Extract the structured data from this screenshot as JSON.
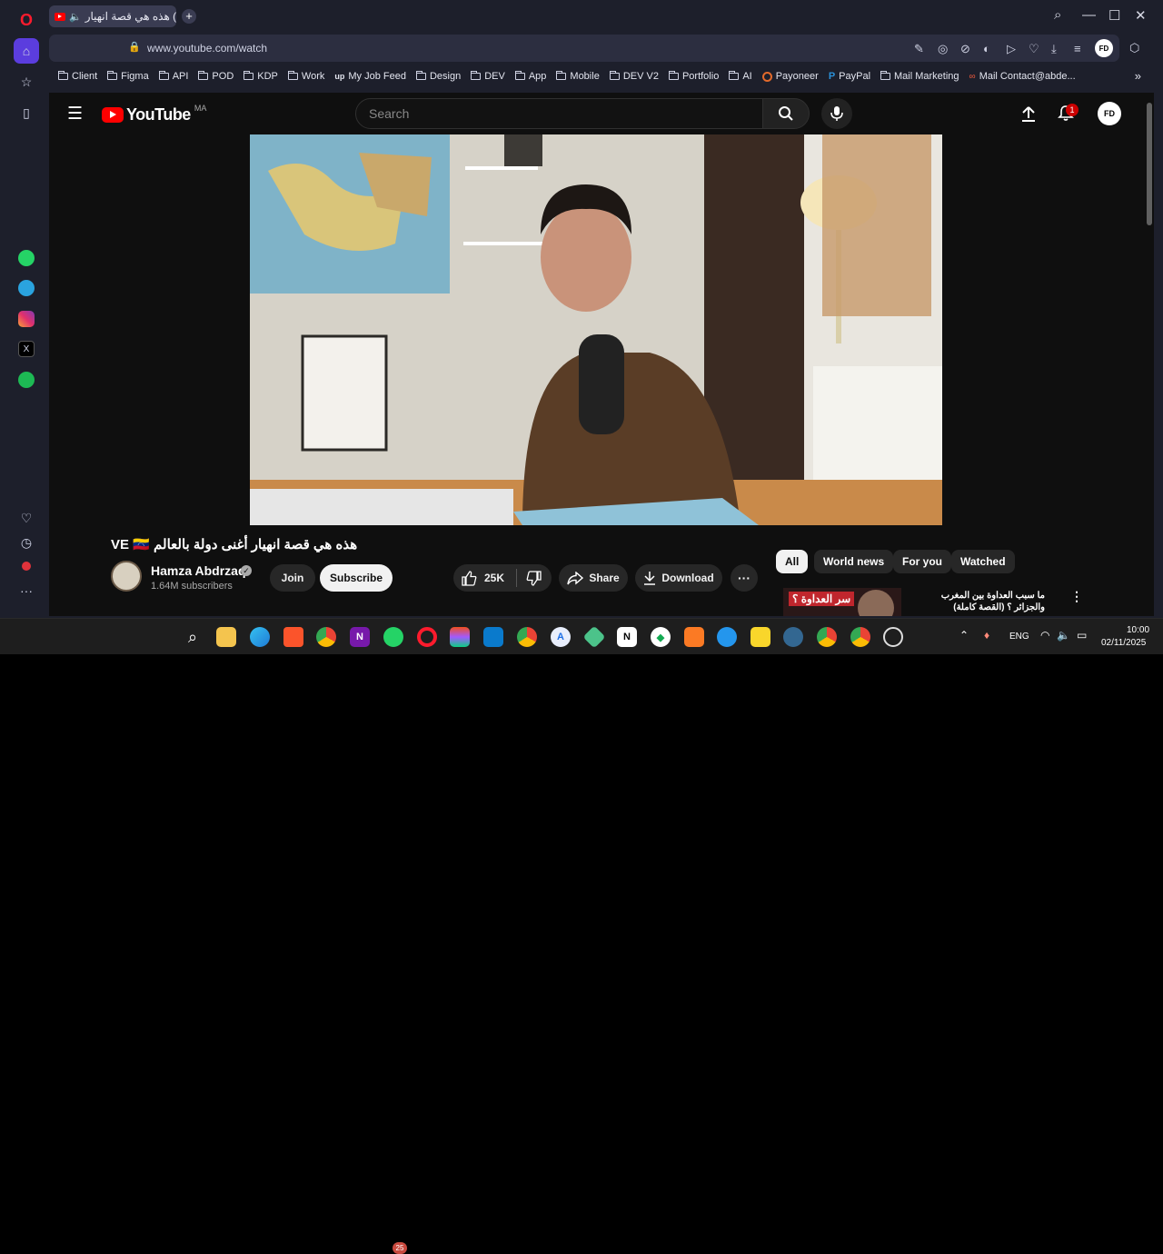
{
  "browser": {
    "tab_title": "(1) هذه هي قصة انهيار",
    "url": "www.youtube.com/watch",
    "bookmarks": [
      "Client",
      "Figma",
      "API",
      "POD",
      "KDP",
      "Work",
      "My Job Feed",
      "Design",
      "DEV",
      "App",
      "Mobile",
      "DEV V2",
      "Portfolio",
      "AI",
      "Payoneer",
      "PayPal",
      "Mail Marketing",
      "Mail Contact@abde..."
    ]
  },
  "youtube": {
    "logo_text": "YouTube",
    "region": "MA",
    "search_placeholder": "Search",
    "notification_count": "1",
    "video_title": "هذه هي قصة انهيار أغنى دولة بالعالم VE 🇻🇪",
    "channel_name": "Hamza Abdrzaq",
    "subscribers": "1.64M subscribers",
    "join_label": "Join",
    "subscribe_label": "Subscribe",
    "likes": "25K",
    "share_label": "Share",
    "download_label": "Download",
    "chips": [
      "All",
      "World news",
      "For you",
      "Watched"
    ],
    "rec_title": "ما سبب العداوة بين المغرب والجزائر ؟ (القصة كاملة)",
    "rec_thumb_text": "سر العداوة ؟"
  },
  "taskbar": {
    "lang": "ENG",
    "time": "10:00",
    "date": "02/11/2025",
    "whatsapp_badge": "25"
  }
}
